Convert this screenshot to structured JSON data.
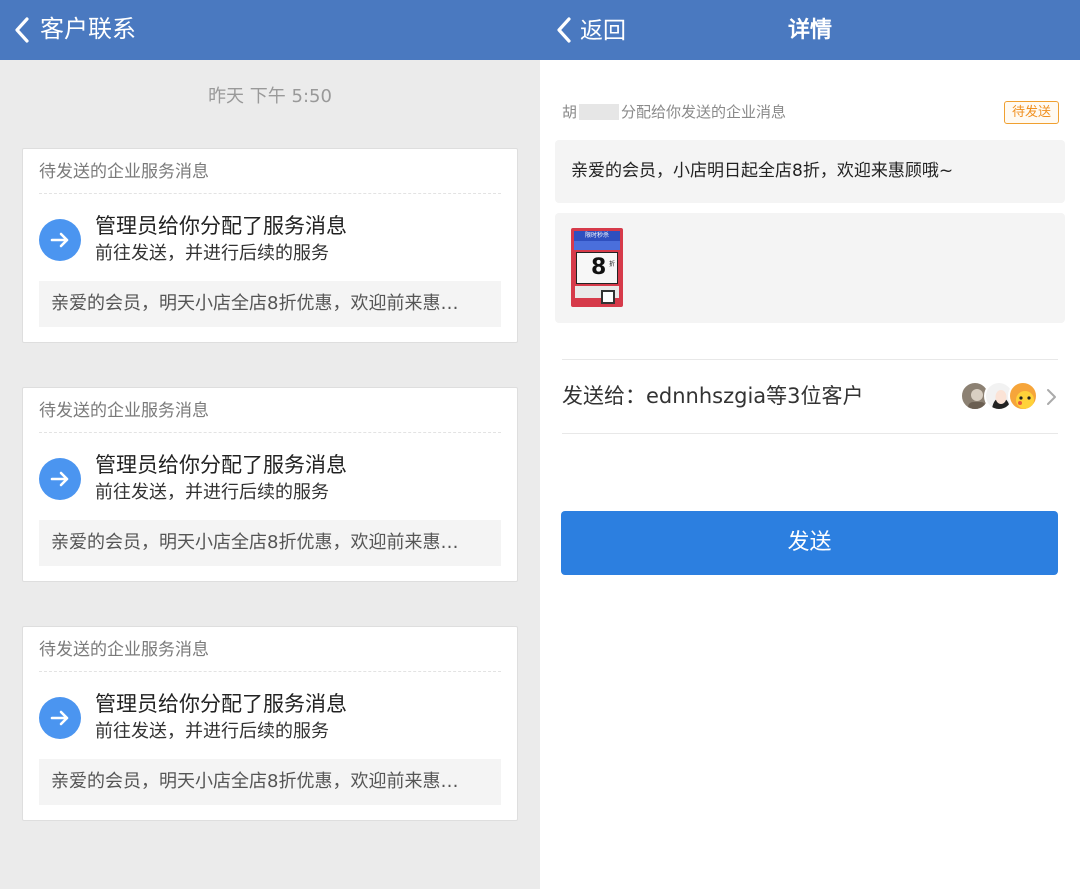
{
  "left_screen": {
    "header": {
      "title": "客户联系"
    },
    "timestamp": "昨天  下午 5:50",
    "cards": [
      {
        "header": "待发送的企业服务消息",
        "title": "管理员给你分配了服务消息",
        "subtitle": "前往发送，并进行后续的服务",
        "preview": "亲爱的会员，明天小店全店8折优惠，欢迎前来惠…"
      },
      {
        "header": "待发送的企业服务消息",
        "title": "管理员给你分配了服务消息",
        "subtitle": "前往发送，并进行后续的服务",
        "preview": "亲爱的会员，明天小店全店8折优惠，欢迎前来惠…"
      },
      {
        "header": "待发送的企业服务消息",
        "title": "管理员给你分配了服务消息",
        "subtitle": "前往发送，并进行后续的服务",
        "preview": "亲爱的会员，明天小店全店8折优惠，欢迎前来惠…"
      }
    ]
  },
  "right_screen": {
    "header": {
      "back_label": "返回",
      "title": "详情"
    },
    "assign": {
      "prefix": "胡",
      "suffix": "分配给你发送的企业消息"
    },
    "status_badge": "待发送",
    "message_text": "亲爱的会员，小店明日起全店8折，欢迎来惠顾哦~",
    "attachment": {
      "banner": "限时秒杀",
      "digit": "8",
      "unit": "折"
    },
    "send_to": "发送给：ednnhszgia等3位客户",
    "send_button": "发送"
  },
  "colors": {
    "header_bg": "#4a79c0",
    "accent_blue": "#2c7fe0",
    "arrow_blue": "#4b95f0",
    "badge_orange": "#f09020"
  },
  "icons": [
    "back-chevron-icon",
    "arrow-right-icon",
    "chevron-right-icon"
  ]
}
